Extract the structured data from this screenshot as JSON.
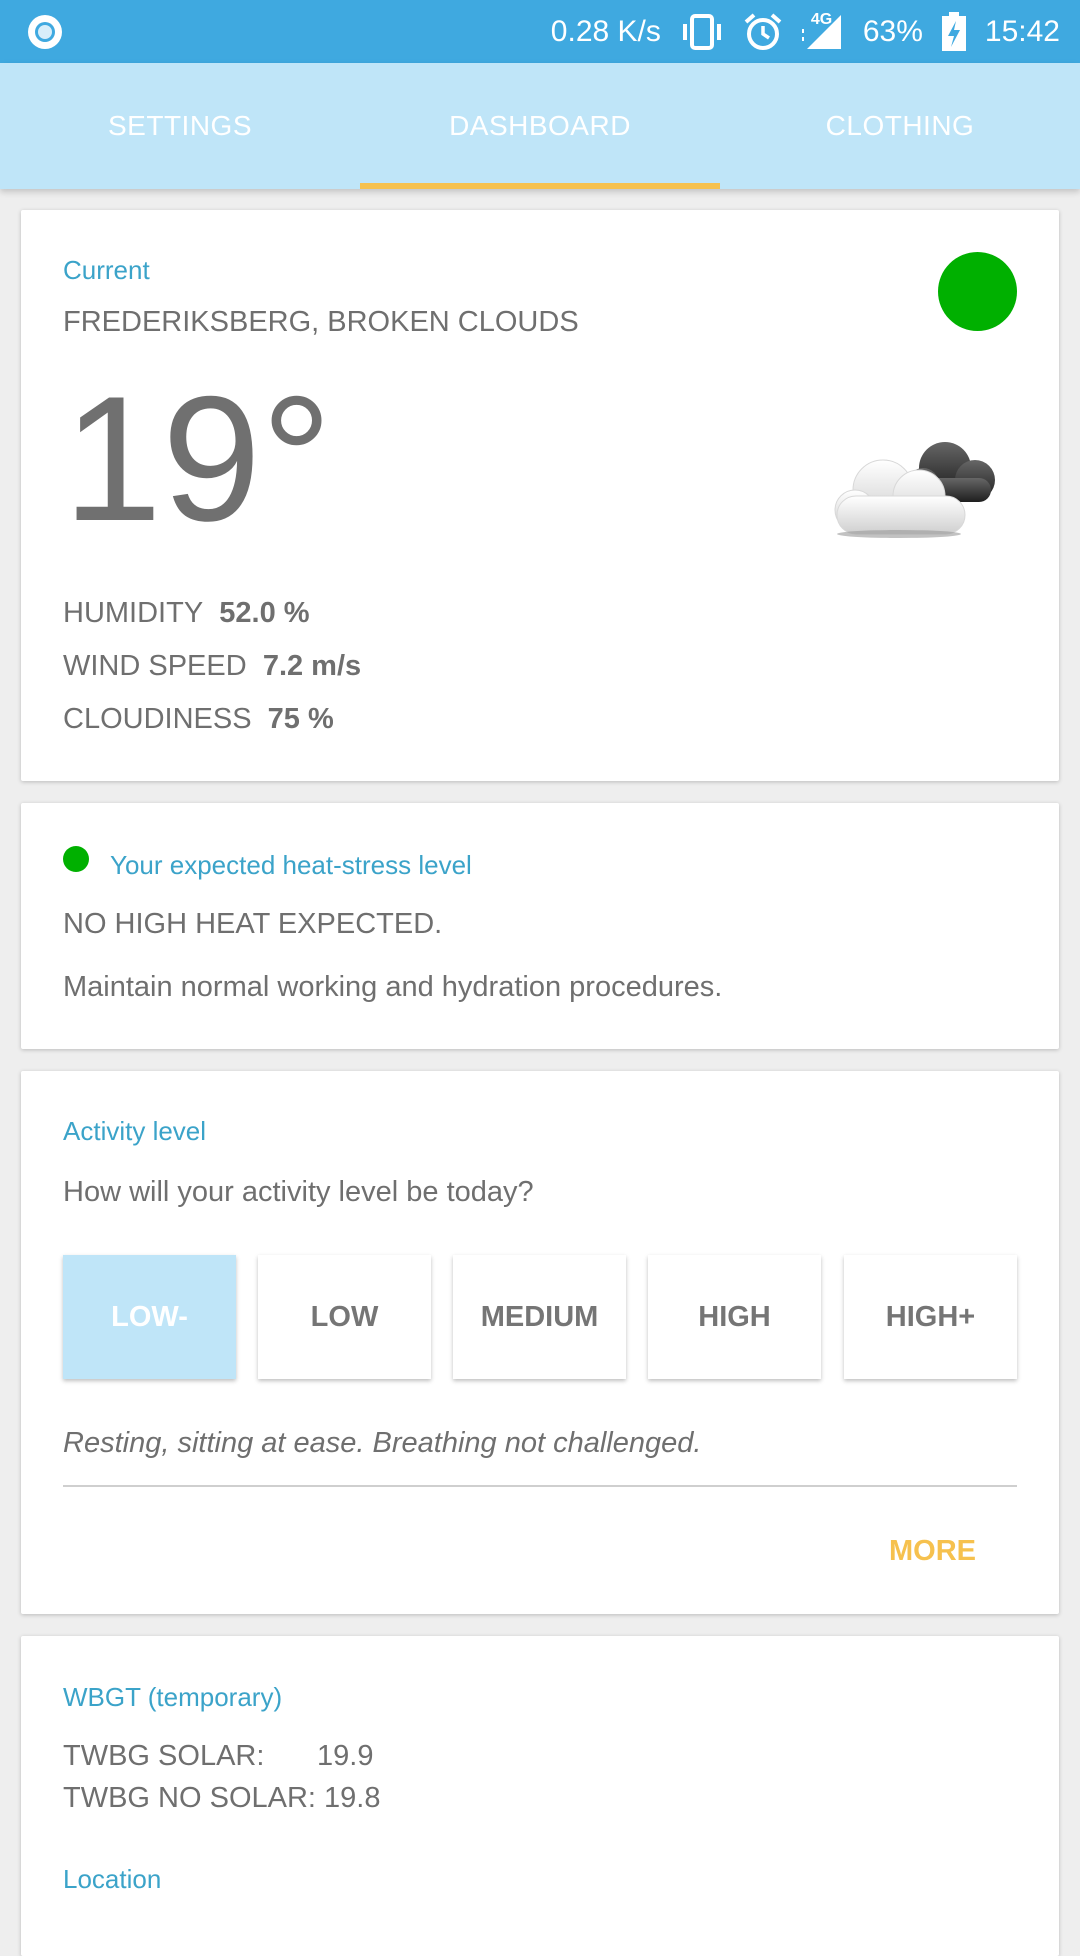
{
  "status_bar": {
    "net_speed": "0.28 K/s",
    "network": "4G",
    "battery": "63%",
    "time": "15:42",
    "icons": [
      "app-circle-icon",
      "vibrate-icon",
      "alarm-icon",
      "signal-icon",
      "battery-charging-icon"
    ]
  },
  "tabs": [
    {
      "label": "SETTINGS"
    },
    {
      "label": "DASHBOARD"
    },
    {
      "label": "CLOTHING"
    }
  ],
  "colors": {
    "status_bar": "#3fa9e0",
    "tab_bar": "#bfe5f8",
    "accent": "#f6c14e",
    "caption": "#3ba3c9",
    "status_green": "#00b000"
  },
  "current": {
    "caption": "Current",
    "location": "FREDERIKSBERG, BROKEN CLOUDS",
    "temperature": "19°",
    "weather_icon": "broken-clouds-icon",
    "humidity_label": "HUMIDITY",
    "humidity_value": "52.0 %",
    "wind_label": "WIND SPEED",
    "wind_value": "7.2 m/s",
    "cloud_label": "CLOUDINESS",
    "cloud_value": "75 %"
  },
  "heat_stress": {
    "caption": "Your expected heat-stress level",
    "headline": "NO HIGH HEAT EXPECTED.",
    "advice": "Maintain normal working and hydration procedures."
  },
  "activity": {
    "caption": "Activity level",
    "question": "How will your activity level be today?",
    "levels": [
      "LOW-",
      "LOW",
      "MEDIUM",
      "HIGH",
      "HIGH+"
    ],
    "selected": "LOW-",
    "description": "Resting, sitting at ease. Breathing not challenged.",
    "more_label": "MORE"
  },
  "wbgt": {
    "caption": "WBGT (temporary)",
    "solar_label": "TWBG SOLAR:",
    "solar_value": "19.9",
    "nosolar_label": "TWBG NO SOLAR:",
    "nosolar_value": "19.8",
    "location_caption": "Location"
  }
}
